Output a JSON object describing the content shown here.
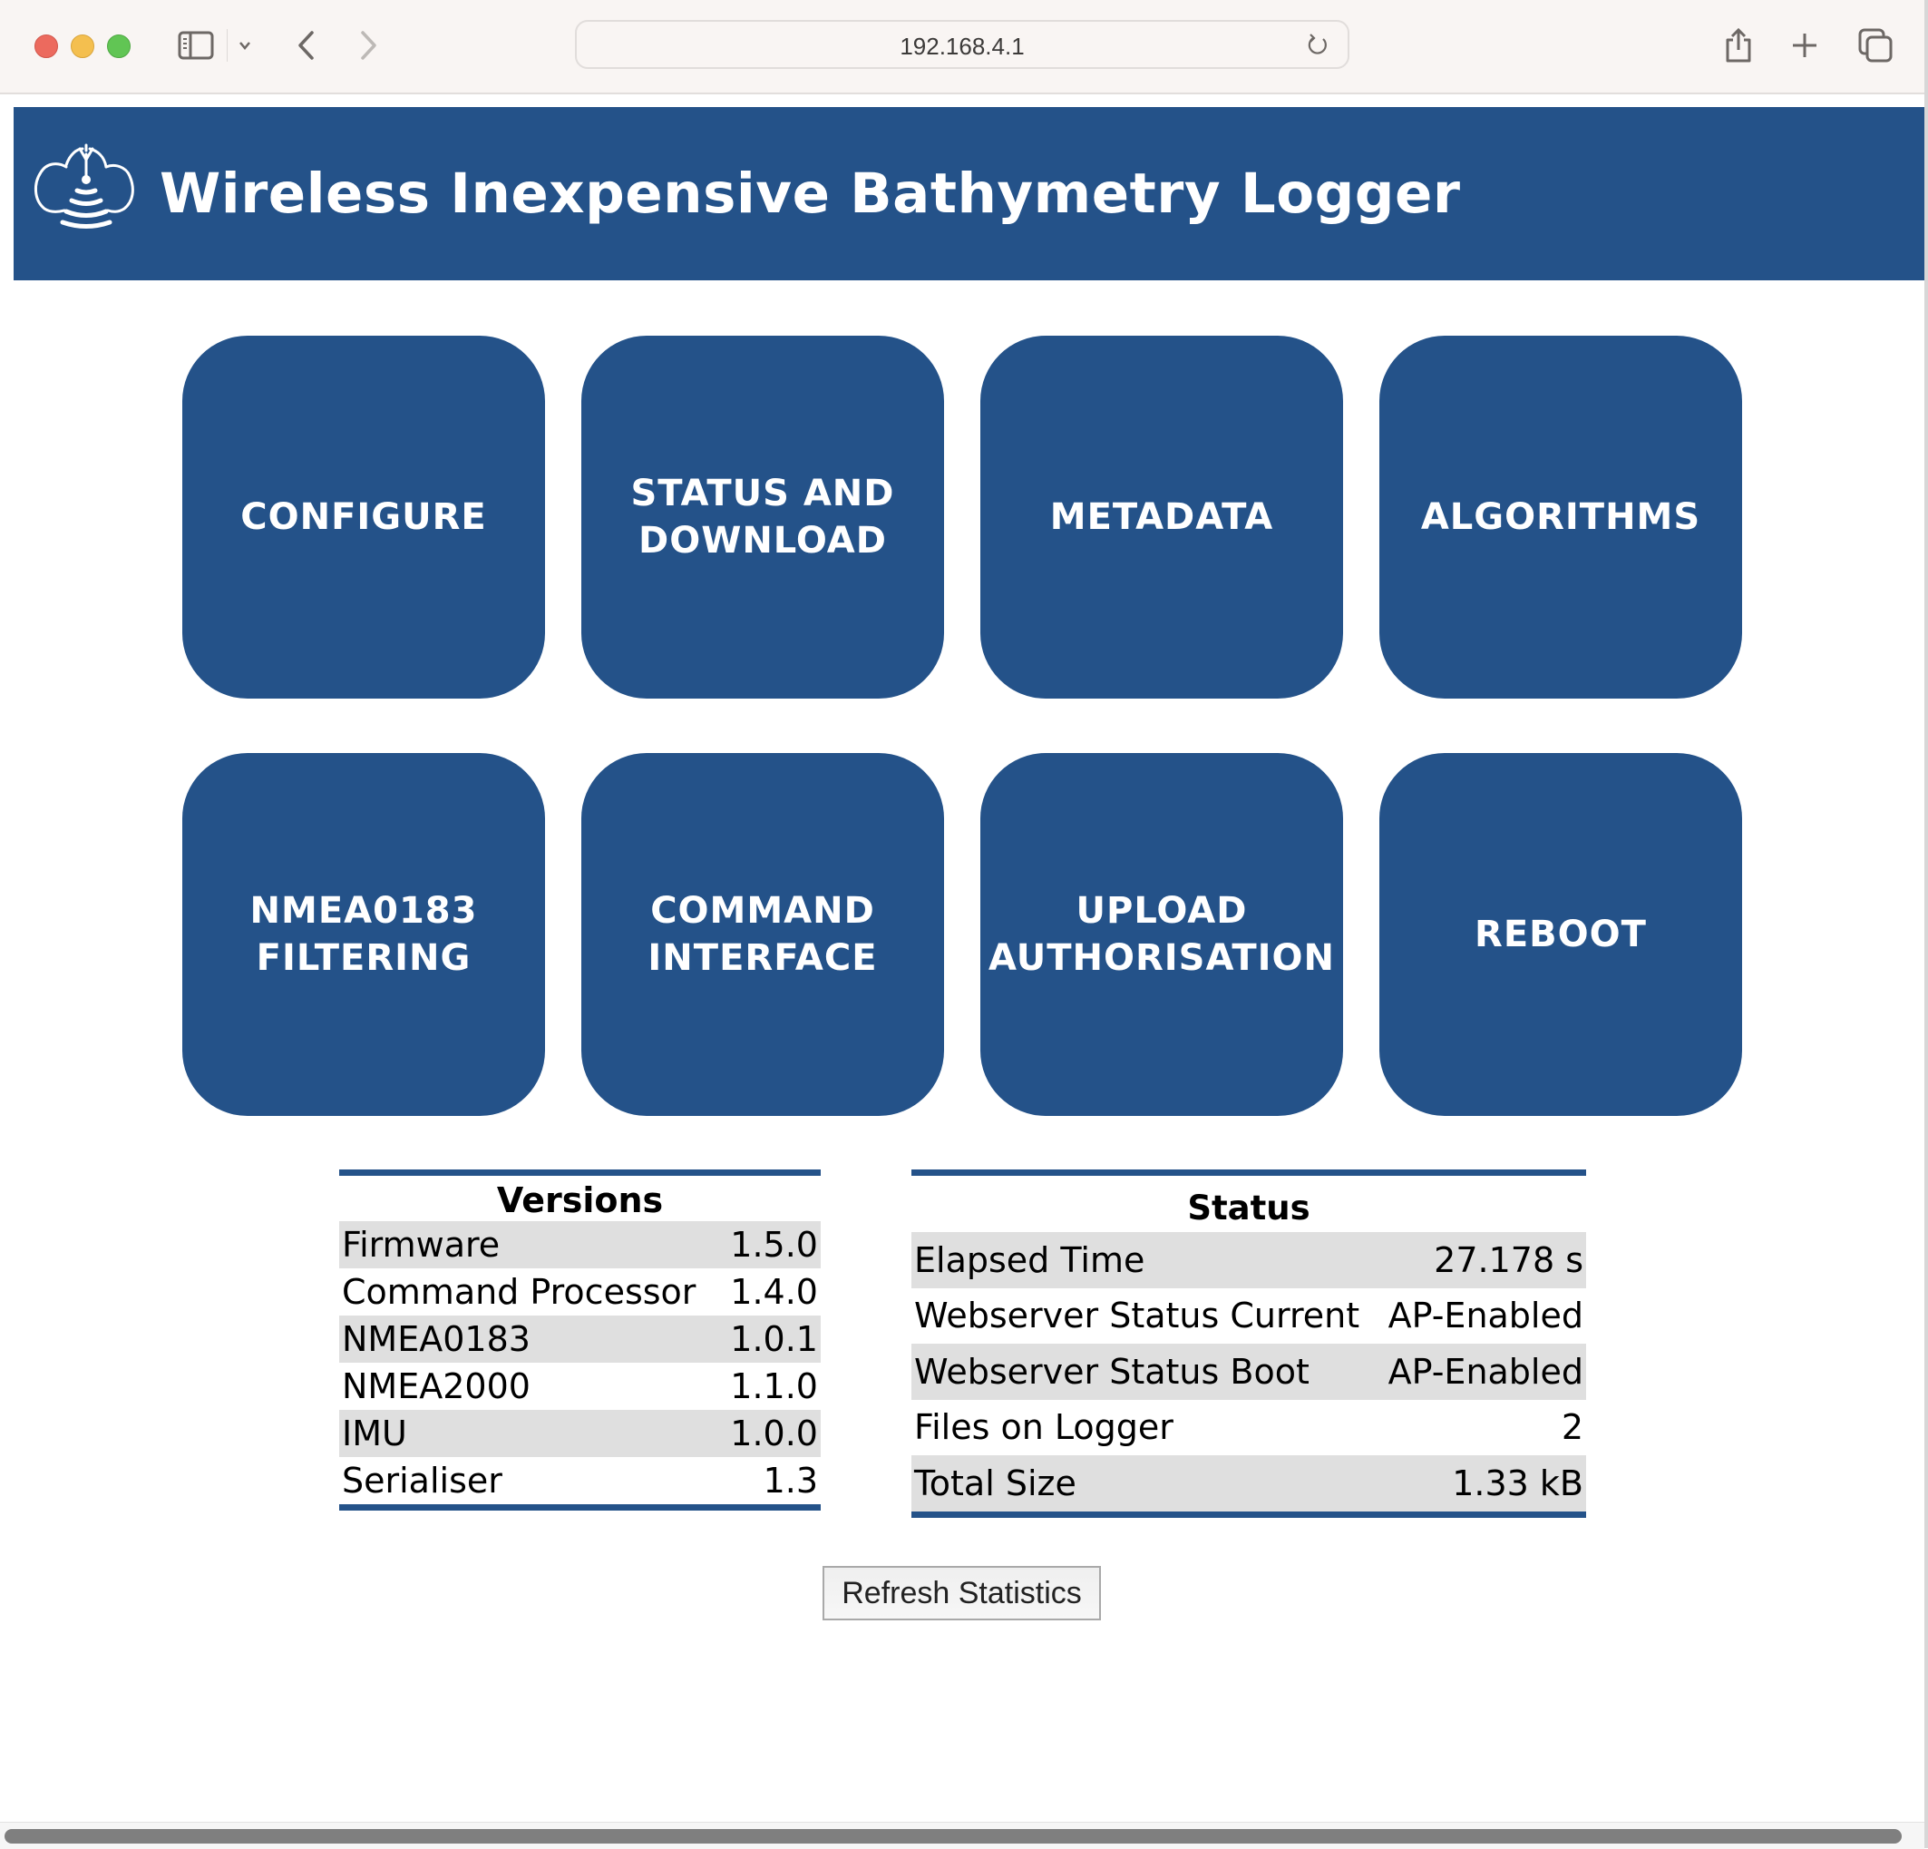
{
  "browser": {
    "url": "192.168.4.1",
    "icons": {
      "close": "traffic-light-close",
      "minimize": "traffic-light-minimize",
      "zoom": "traffic-light-zoom",
      "sidebar": "sidebar-icon",
      "chevron": "chevron-down-icon",
      "back": "back-arrow-icon",
      "forward": "forward-arrow-icon",
      "reload": "reload-icon",
      "share": "share-icon",
      "new_tab": "plus-icon",
      "tabs": "tab-overview-icon"
    }
  },
  "header": {
    "title": "Wireless Inexpensive Bathymetry Logger",
    "logo": "logger-logo-icon",
    "brand_color": "#245289"
  },
  "menu": [
    {
      "id": "configure",
      "label": "CONFIGURE"
    },
    {
      "id": "status-download",
      "label": "STATUS AND\nDOWNLOAD"
    },
    {
      "id": "metadata",
      "label": "METADATA"
    },
    {
      "id": "algorithms",
      "label": "ALGORITHMS"
    },
    {
      "id": "nmea0183-filtering",
      "label": "NMEA0183\nFILTERING"
    },
    {
      "id": "command-interface",
      "label": "COMMAND\nINTERFACE"
    },
    {
      "id": "upload-authorisation",
      "label": "UPLOAD\nAUTHORISATION"
    },
    {
      "id": "reboot",
      "label": "REBOOT"
    }
  ],
  "versions": {
    "title": "Versions",
    "rows": [
      {
        "name": "Firmware",
        "value": "1.5.0"
      },
      {
        "name": "Command Processor",
        "value": "1.4.0"
      },
      {
        "name": "NMEA0183",
        "value": "1.0.1"
      },
      {
        "name": "NMEA2000",
        "value": "1.1.0"
      },
      {
        "name": "IMU",
        "value": "1.0.0"
      },
      {
        "name": "Serialiser",
        "value": "1.3"
      }
    ]
  },
  "status": {
    "title": "Status",
    "rows": [
      {
        "name": "Elapsed Time",
        "value": "27.178 s"
      },
      {
        "name": "Webserver Status Current",
        "value": "AP-Enabled"
      },
      {
        "name": "Webserver Status Boot",
        "value": "AP-Enabled"
      },
      {
        "name": "Files on Logger",
        "value": "2"
      },
      {
        "name": "Total Size",
        "value": "1.33 kB"
      }
    ]
  },
  "refresh_button": {
    "label": "Refresh Statistics"
  }
}
